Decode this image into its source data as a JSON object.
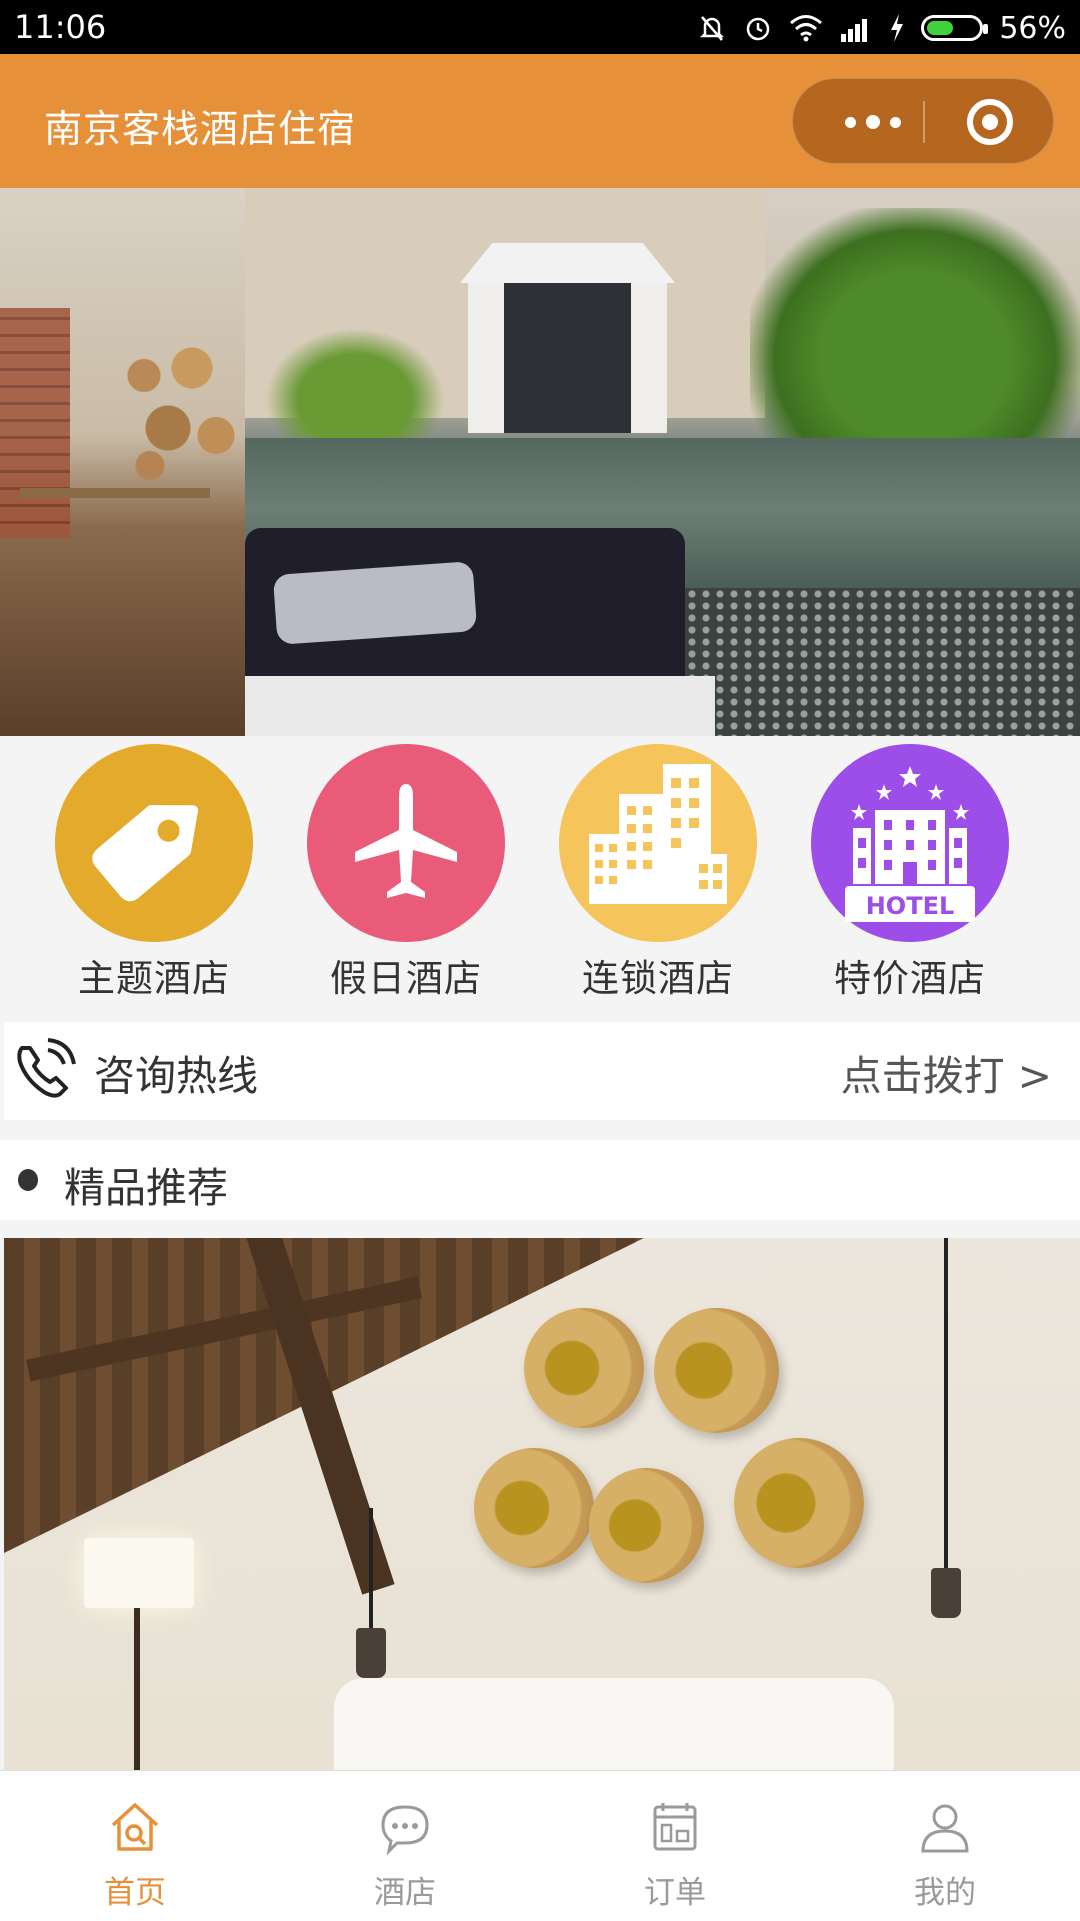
{
  "status_bar": {
    "time": "11:06",
    "battery": "56%",
    "battery_level": 0.56
  },
  "nav_bar": {
    "title": "南京客栈酒店住宿",
    "background_color": "#e6913a"
  },
  "banner": {
    "slides": 2,
    "active_index": 0
  },
  "categories": [
    {
      "label": "主题酒店",
      "icon": "tag-icon",
      "color": "#e3aa2b"
    },
    {
      "label": "假日酒店",
      "icon": "airplane-icon",
      "color": "#ea5a79"
    },
    {
      "label": "连锁酒店",
      "icon": "buildings-icon",
      "color": "#f5c45b"
    },
    {
      "label": "特价酒店",
      "icon": "hotel-icon",
      "color": "#9d4ee8",
      "icon_text": "HOTEL"
    }
  ],
  "hotline": {
    "label": "咨询热线",
    "action": "点击拨打 >",
    "icon": "phone-icon"
  },
  "section": {
    "title": "精品推荐"
  },
  "tab_bar": {
    "items": [
      {
        "label": "首页",
        "icon": "home-icon",
        "active": true
      },
      {
        "label": "酒店",
        "icon": "chat-icon",
        "active": false
      },
      {
        "label": "订单",
        "icon": "order-icon",
        "active": false
      },
      {
        "label": "我的",
        "icon": "user-icon",
        "active": false
      }
    ],
    "active_color": "#e6913a",
    "inactive_color": "#9a9a9a"
  }
}
